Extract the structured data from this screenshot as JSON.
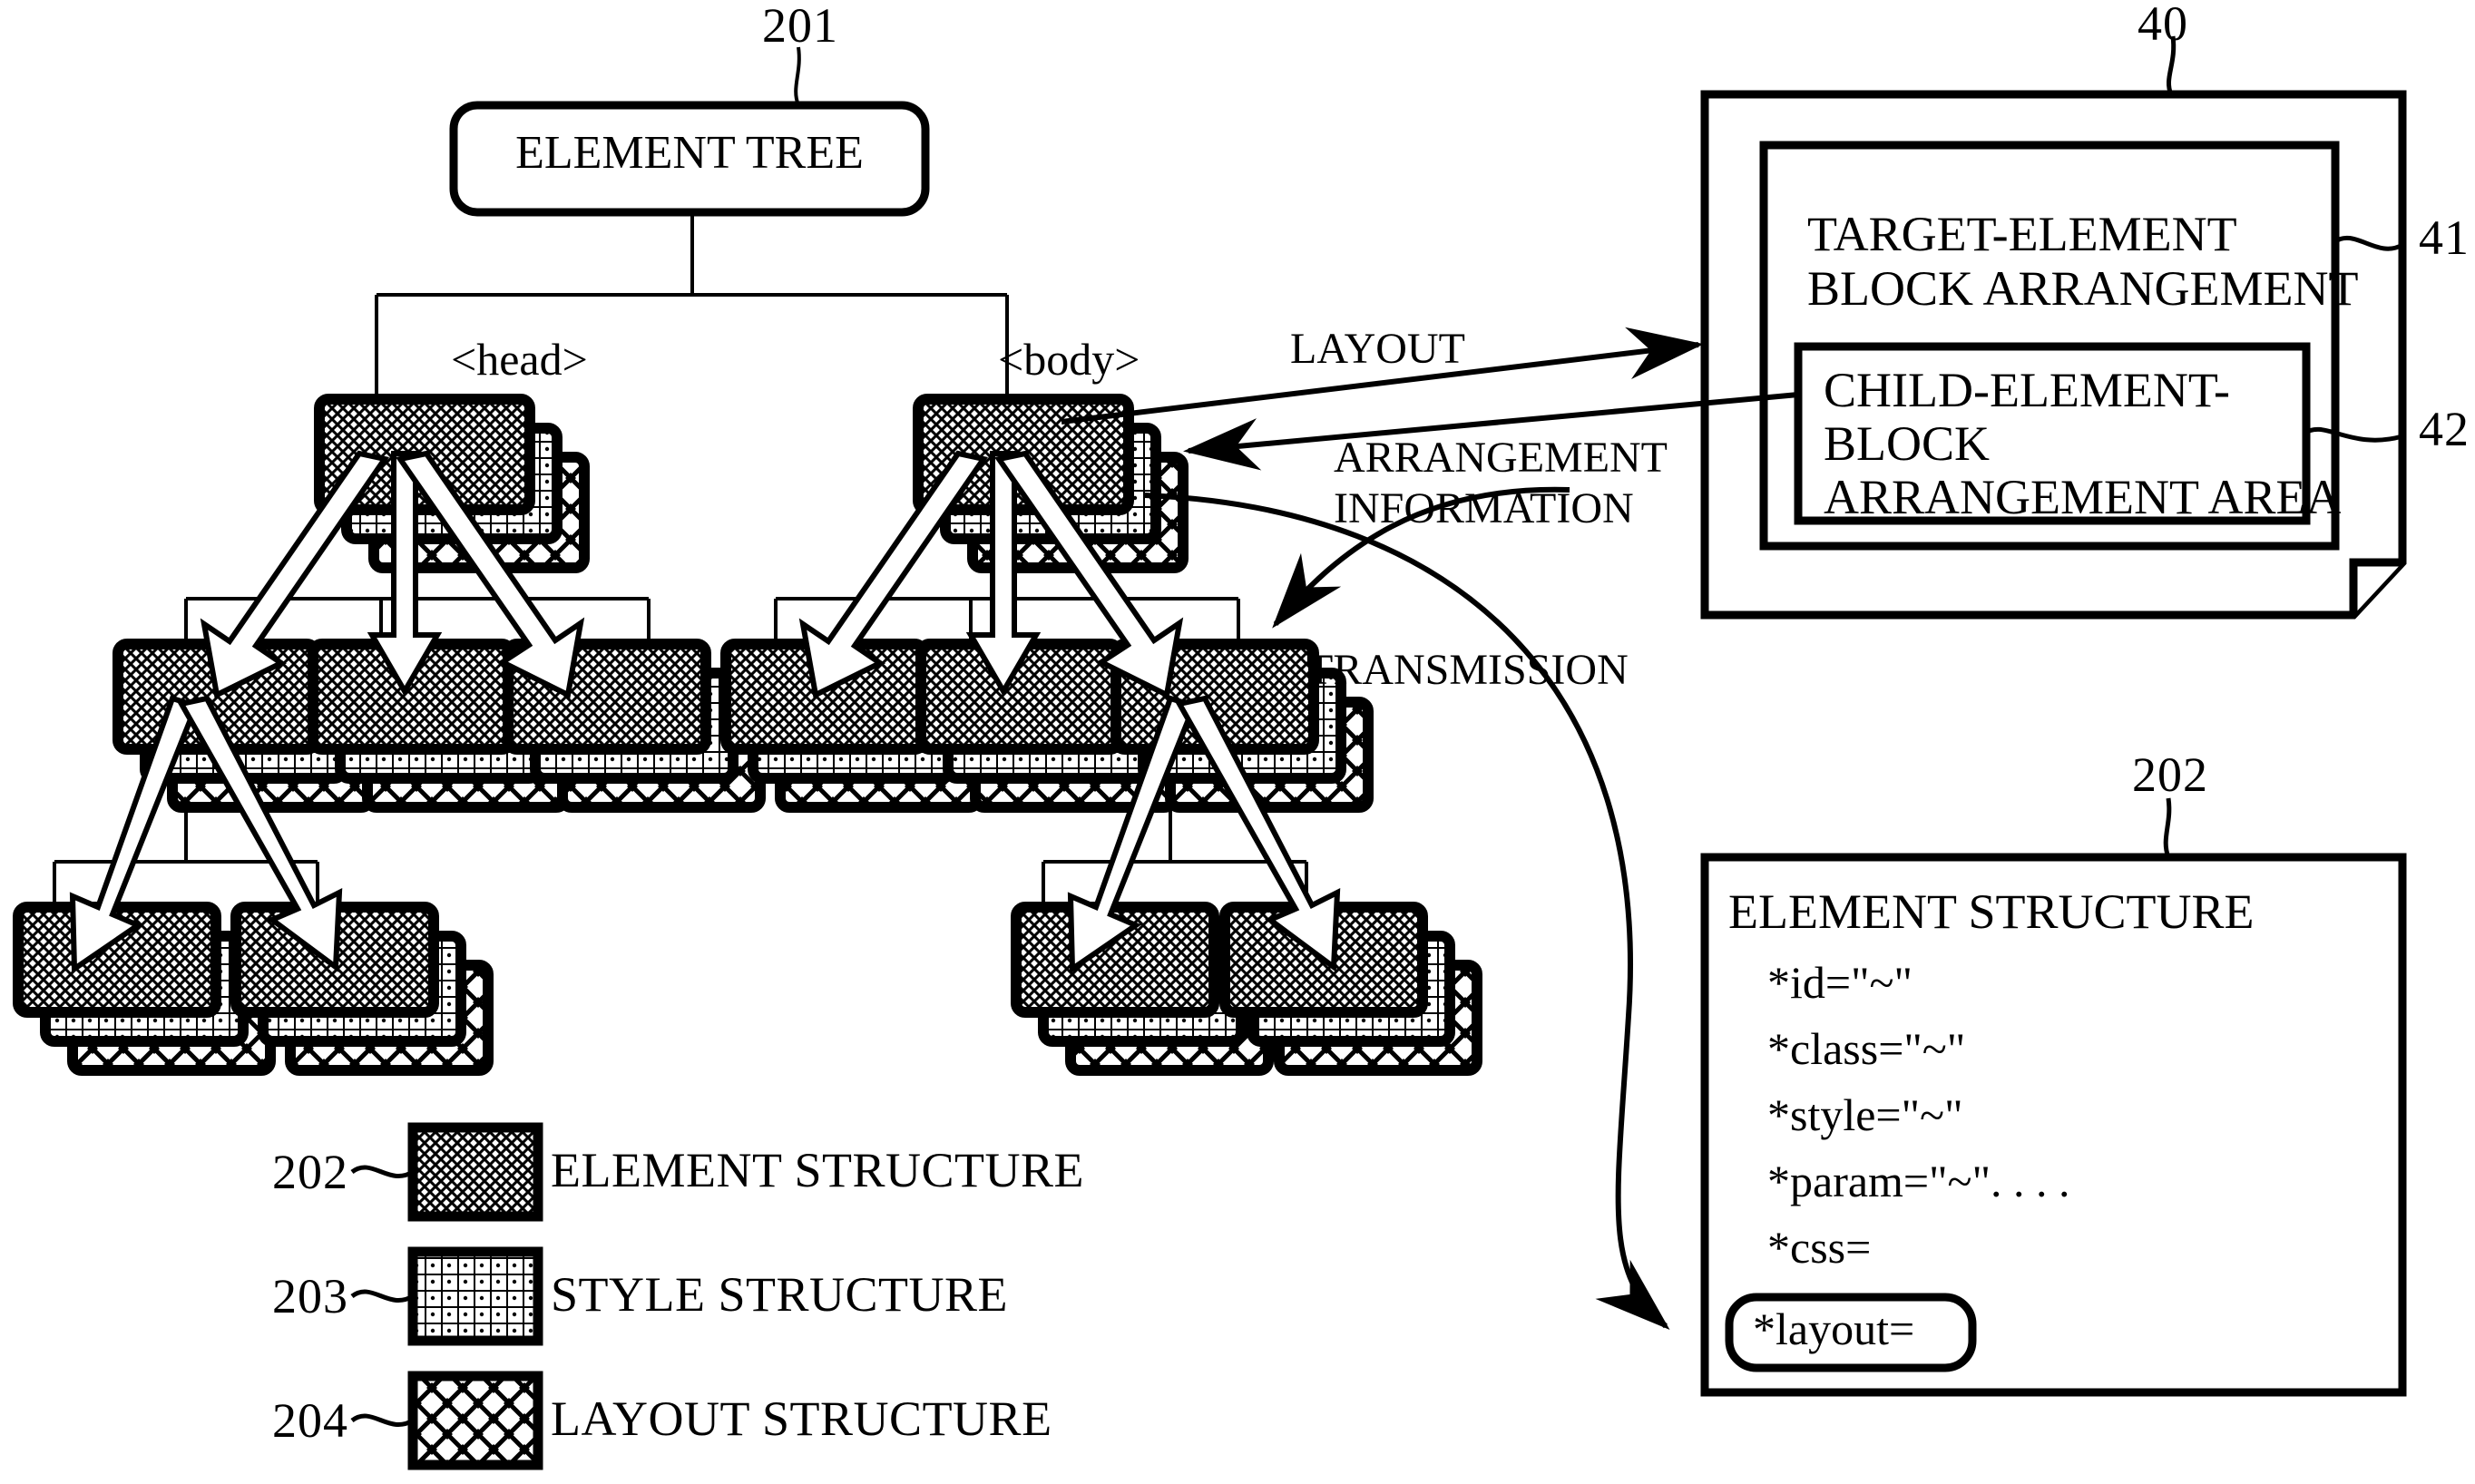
{
  "figure": {
    "root_box": {
      "label": "ELEMENT TREE",
      "ref": "201"
    },
    "tree": {
      "child_tags": [
        "<head>",
        "<body>"
      ]
    },
    "arrows": {
      "layout": "LAYOUT",
      "arrangement_information_line1": "ARRANGEMENT",
      "arrangement_information_line2": "INFORMATION",
      "transmission": "TRANSMISSION"
    },
    "layout_panel": {
      "ref": "40",
      "outer_ref": "41",
      "inner_ref": "42",
      "outer_title_line1": "TARGET-ELEMENT",
      "outer_title_line2": "BLOCK ARRANGEMENT",
      "inner_title_line1": "CHILD-ELEMENT-",
      "inner_title_line2": "BLOCK",
      "inner_title_line3": "ARRANGEMENT AREA"
    },
    "structure_panel": {
      "ref": "202",
      "title": "ELEMENT STRUCTURE",
      "attributes": [
        "*id=\"~\"",
        "*class=\"~\"",
        "*style=\"~\"",
        "*param=\"~\". . . .",
        "*css="
      ],
      "highlight_attribute": "*layout="
    },
    "legend": [
      {
        "ref": "202",
        "label": "ELEMENT STRUCTURE",
        "pattern": "element-crosshatch"
      },
      {
        "ref": "203",
        "label": "STYLE STRUCTURE",
        "pattern": "style-grid"
      },
      {
        "ref": "204",
        "label": "LAYOUT STRUCTURE",
        "pattern": "layout-diamond"
      }
    ],
    "colors": {
      "ink": "#000000",
      "paper": "#ffffff"
    }
  }
}
